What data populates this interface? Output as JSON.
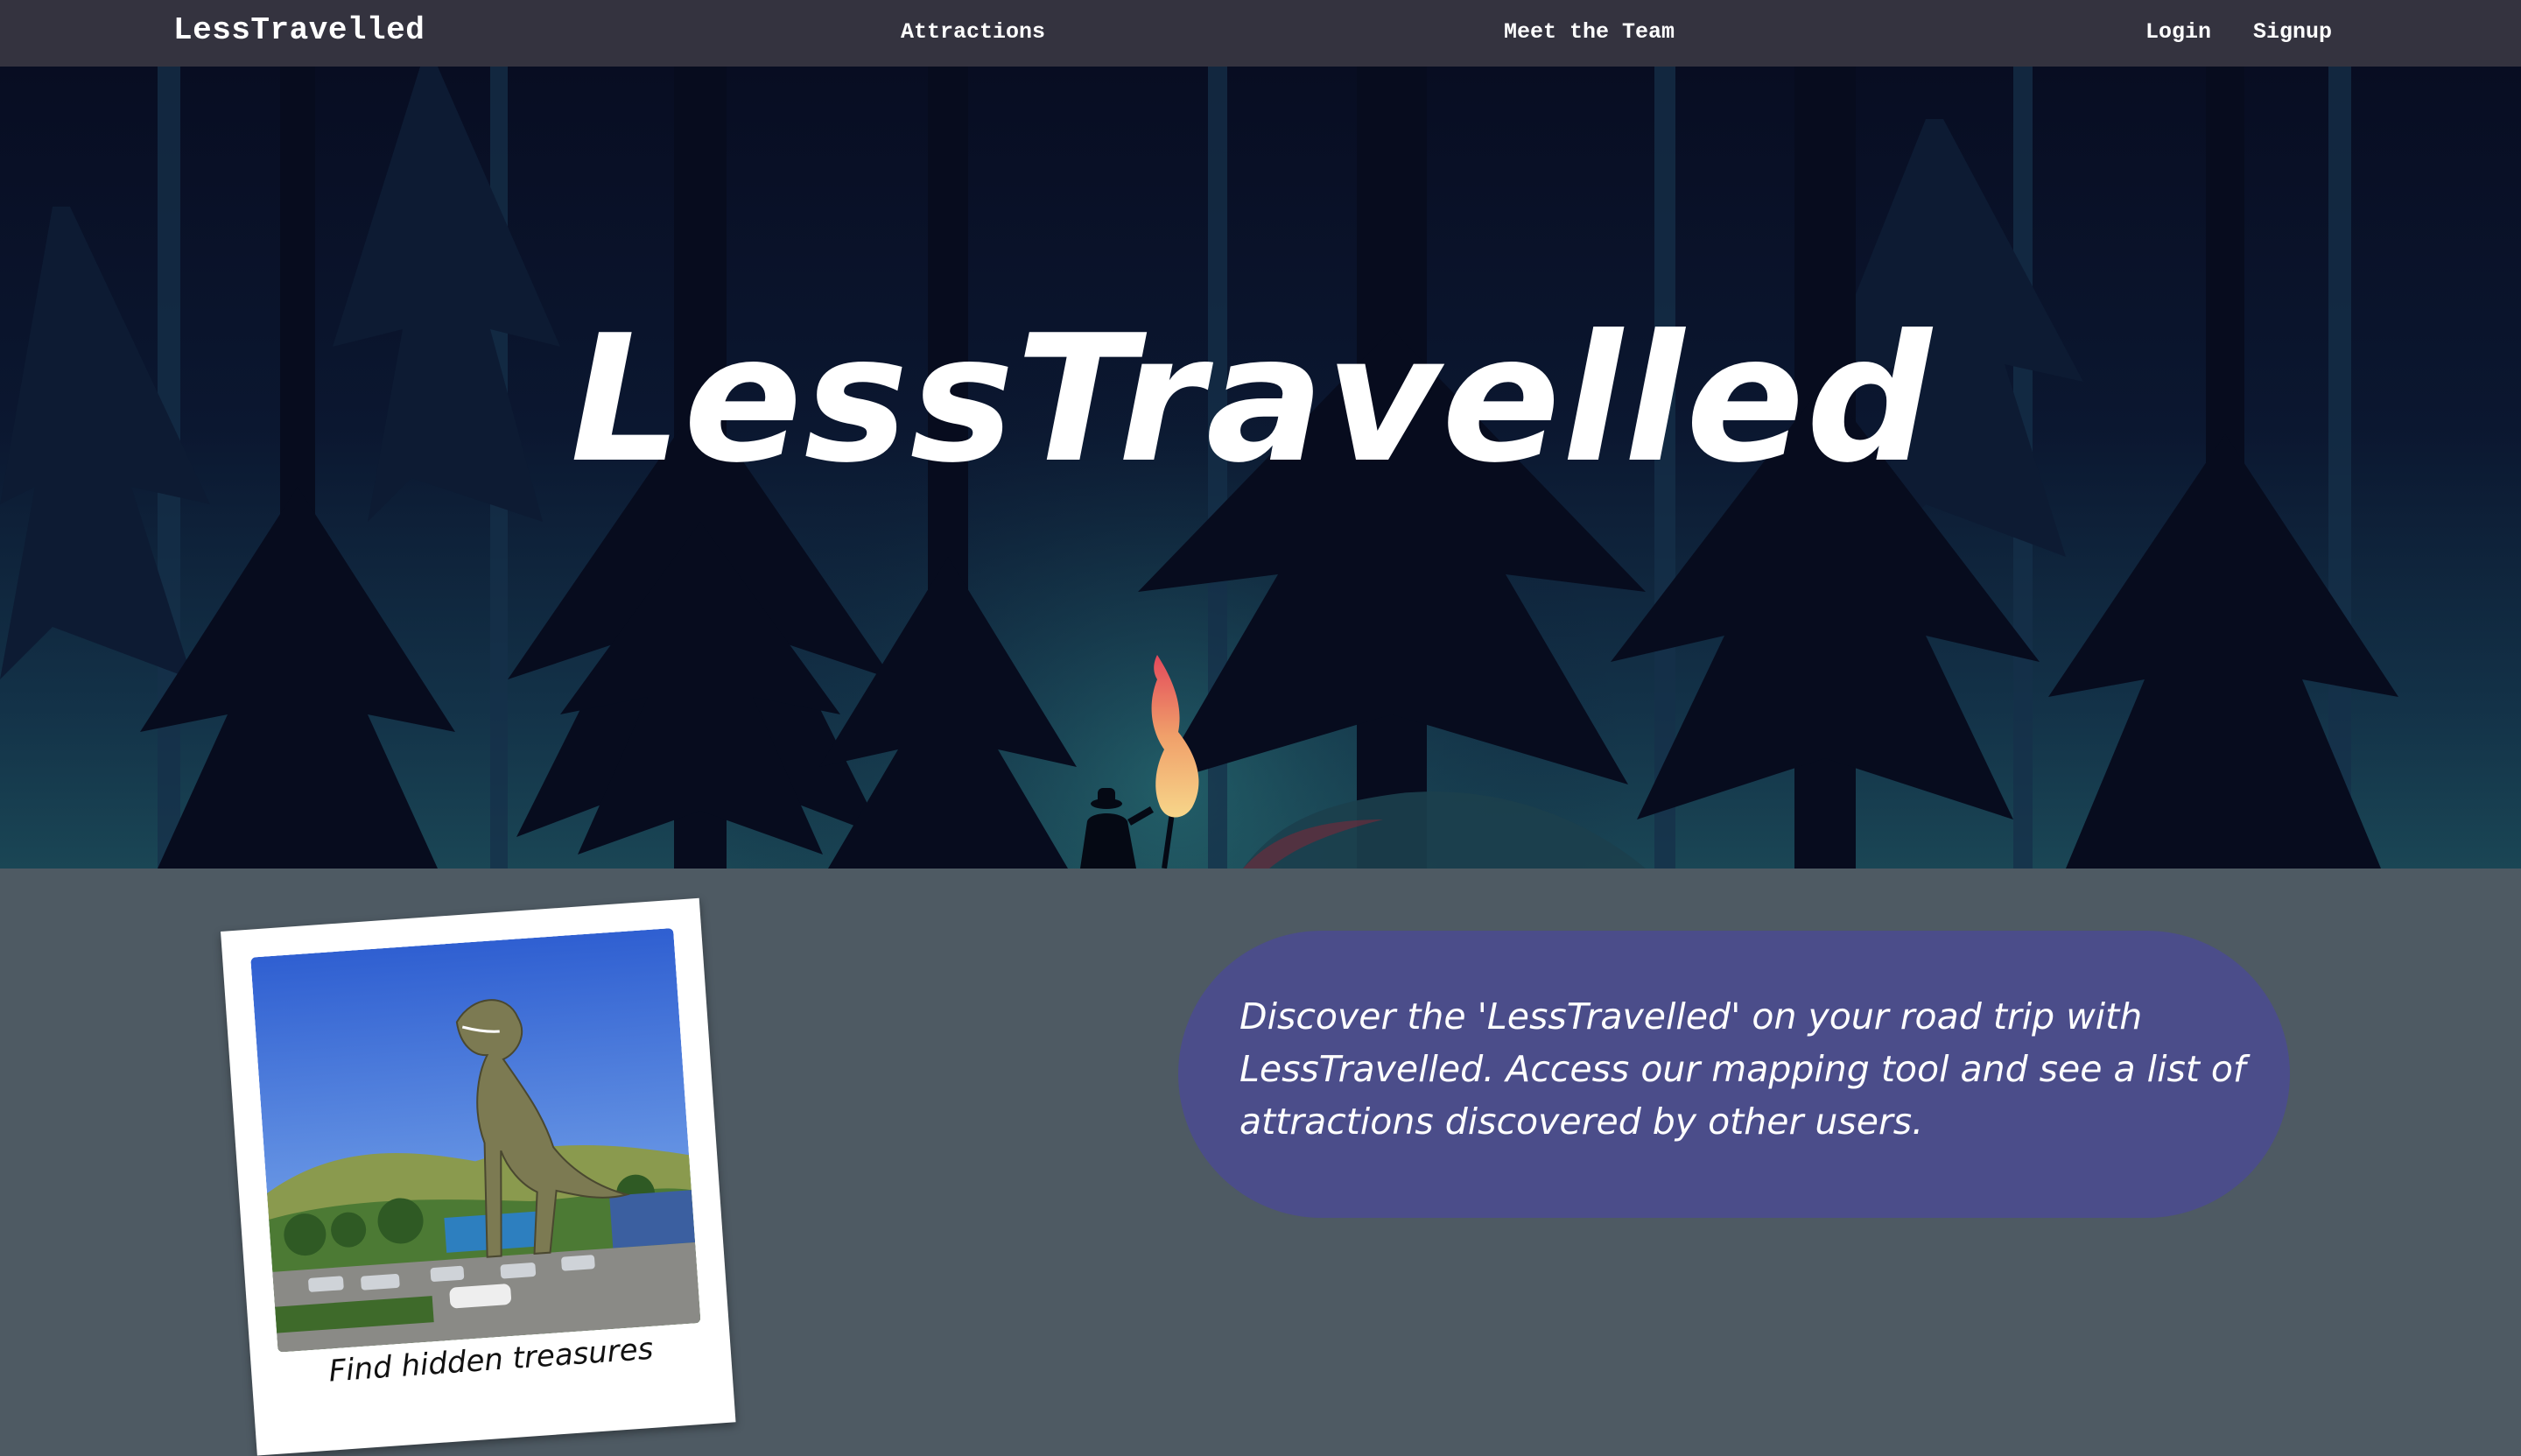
{
  "navbar": {
    "brand": "LessTravelled",
    "links": {
      "attractions": "Attractions",
      "team": "Meet the Team",
      "login": "Login",
      "signup": "Signup"
    }
  },
  "hero": {
    "title": "LessTravelled"
  },
  "polaroid": {
    "caption": "Find hidden treasures"
  },
  "intro": {
    "text": "Discover the 'LessTravelled' on your road trip with LessTravelled. Access our mapping tool and see a list of attractions discovered by other users."
  },
  "colors": {
    "navbar_bg": "#34333f",
    "page_bg": "#4e5a63",
    "bubble_bg": "#4b4d8a",
    "hero_dark": "#080d22"
  },
  "icons": {
    "torch": "torch-flame-icon",
    "explorer": "explorer-silhouette-icon"
  }
}
